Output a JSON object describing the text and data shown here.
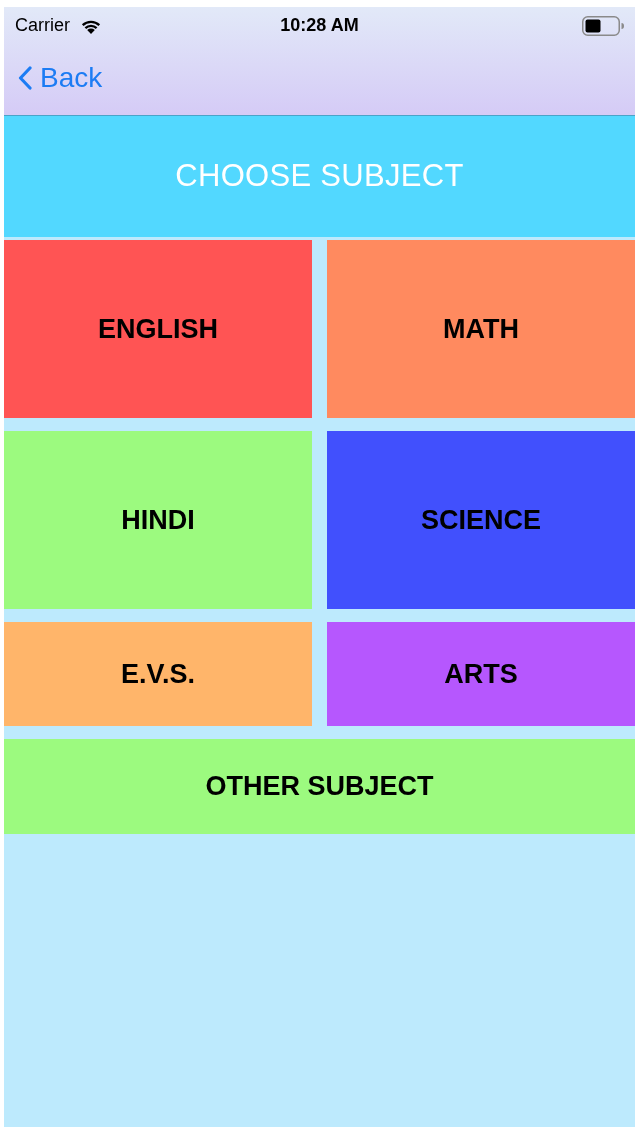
{
  "status_bar": {
    "carrier": "Carrier",
    "time": "10:28 AM"
  },
  "nav_bar": {
    "back_label": "Back"
  },
  "header": {
    "title": "CHOOSE SUBJECT"
  },
  "subjects": [
    {
      "label": "ENGLISH",
      "color": "#ff5454",
      "kind": "half"
    },
    {
      "label": "MATH",
      "color": "#ff8a5f",
      "kind": "half"
    },
    {
      "label": "HINDI",
      "color": "#9cfa7f",
      "kind": "half"
    },
    {
      "label": "SCIENCE",
      "color": "#4150fd",
      "kind": "half"
    },
    {
      "label": "E.V.S.",
      "color": "#ffb56a",
      "kind": "half"
    },
    {
      "label": "ARTS",
      "color": "#b657fe",
      "kind": "half"
    },
    {
      "label": "OTHER SUBJECT",
      "color": "#9cfa7f",
      "kind": "full"
    }
  ]
}
